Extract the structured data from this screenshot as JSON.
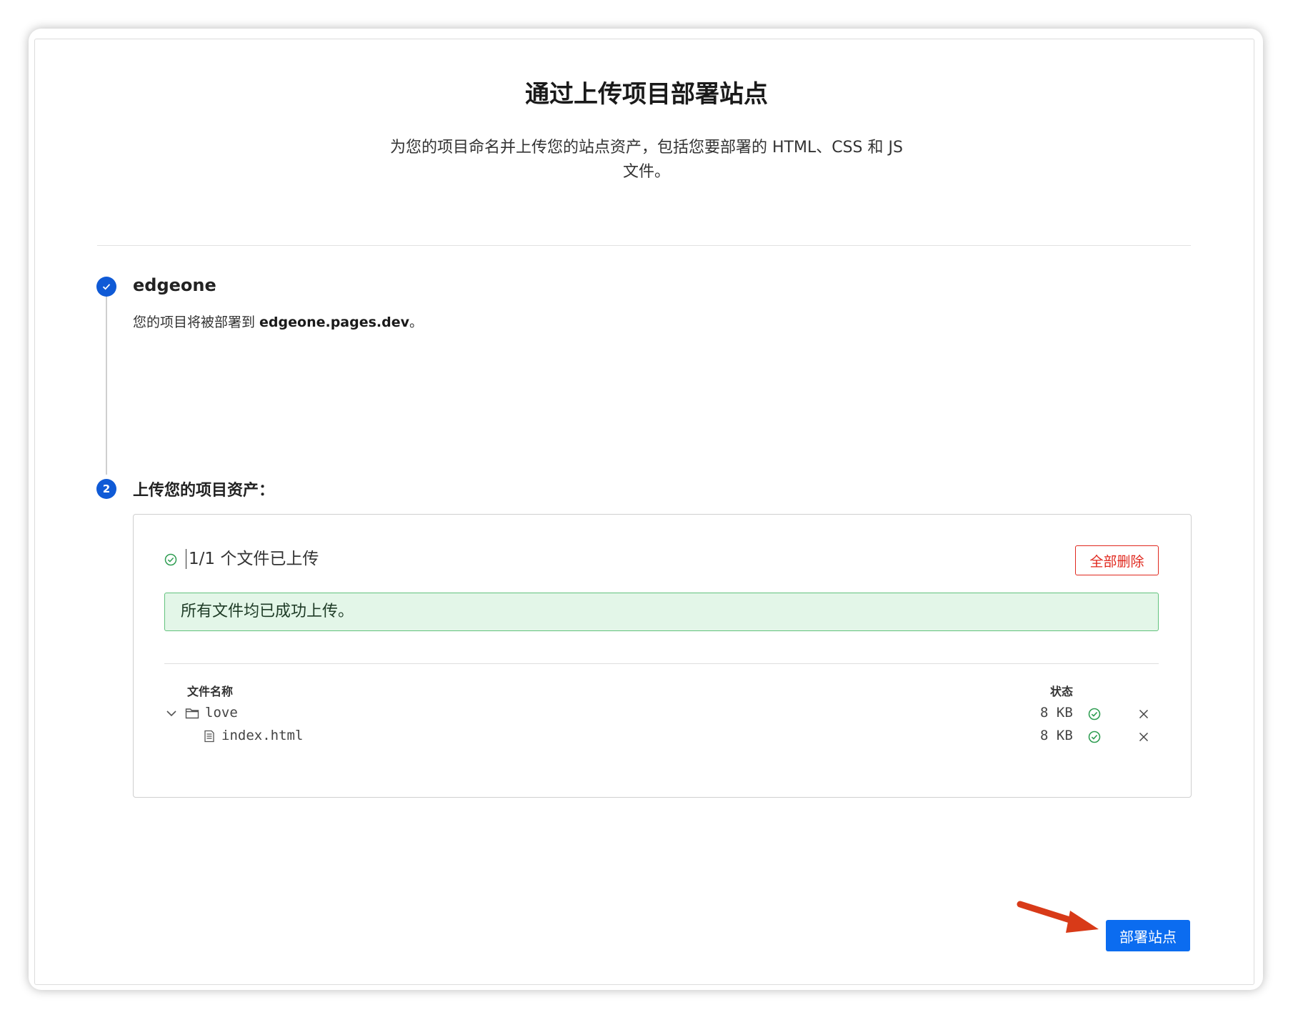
{
  "page": {
    "title": "通过上传项目部署站点",
    "subtitle": "为您的项目命名并上传您的站点资产，包括您要部署的 HTML、CSS 和 JS 文件。"
  },
  "step1": {
    "number": "✓",
    "project_name": "edgeone",
    "desc_prefix": "您的项目将被部署到 ",
    "domain": "edgeone.pages.dev",
    "desc_suffix": "。"
  },
  "step2": {
    "number": "2",
    "title": "上传您的项目资产："
  },
  "upload": {
    "status_text": "1/1 个文件已上传",
    "delete_all_label": "全部删除",
    "success_message": "所有文件均已成功上传。",
    "columns": {
      "name": "文件名称",
      "status": "状态"
    },
    "files": [
      {
        "name": "love",
        "type": "folder",
        "size": "8 KB"
      },
      {
        "name": "index.html",
        "type": "file",
        "size": "8 KB"
      }
    ]
  },
  "footer": {
    "deploy_label": "部署站点"
  },
  "colors": {
    "primary": "#0b6cf0",
    "step_blue": "#0f5ad6",
    "danger": "#e0281e",
    "success_border": "#62c27d",
    "success_bg": "#e3f6e8",
    "arrow": "#d83a18"
  }
}
